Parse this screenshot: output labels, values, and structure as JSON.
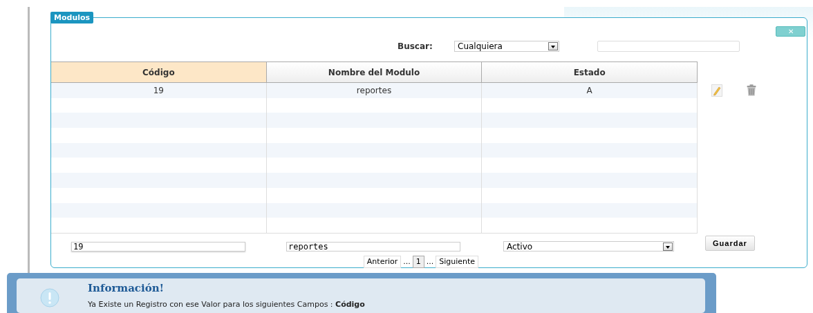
{
  "panel": {
    "title": "Modulos",
    "close_label": "✕"
  },
  "search": {
    "label": "Buscar:",
    "field": "Cualquiera"
  },
  "table": {
    "columns": [
      {
        "label": "Código",
        "selected": true
      },
      {
        "label": "Nombre del Modulo",
        "selected": false
      },
      {
        "label": "Estado",
        "selected": false
      }
    ],
    "rows": [
      {
        "cells": [
          "19",
          "reportes",
          "A"
        ]
      }
    ]
  },
  "form": {
    "codigo": "19",
    "nombre": "reportes",
    "estado": "Activo",
    "button": "Guardar"
  },
  "pagination": {
    "previous": "Anterior",
    "pages": [
      {
        "label": "1",
        "selected": true
      }
    ],
    "ellipsis": "...",
    "next": "Siguiente"
  },
  "notification": {
    "title": "Información!",
    "message": "Ya Existe un Registro con ese Valor para los siguientes Campos : **Código**"
  }
}
